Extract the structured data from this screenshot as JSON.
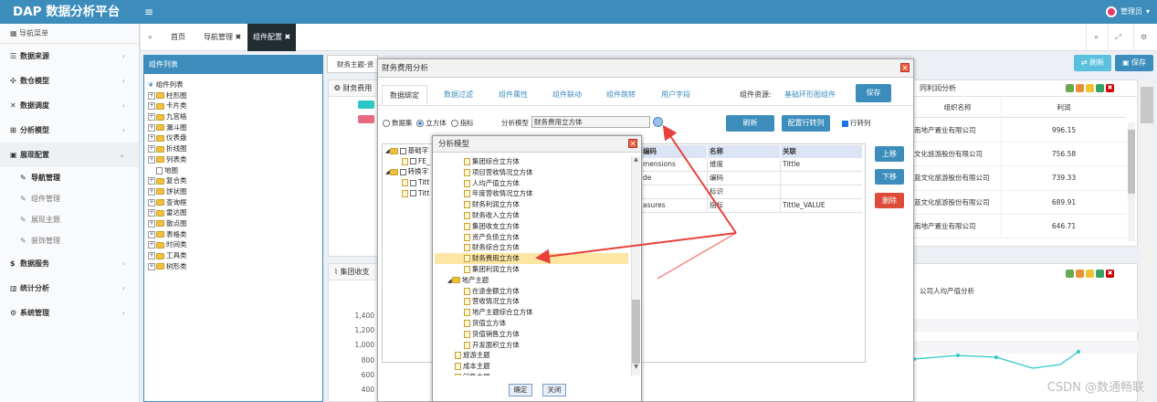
{
  "app": {
    "title": "DAP 数据分析平台",
    "user": "管理员"
  },
  "sidebar": {
    "header": "导航菜单",
    "items": [
      {
        "label": "数据来源",
        "icon": "database-icon"
      },
      {
        "label": "数仓模型",
        "icon": "cubes-icon"
      },
      {
        "label": "数据调度",
        "icon": "random-icon"
      },
      {
        "label": "分析模型",
        "icon": "sitemap-icon"
      },
      {
        "label": "展现配置",
        "icon": "layout-icon"
      },
      {
        "label": "数据服务",
        "icon": "dollar-icon"
      },
      {
        "label": "统计分析",
        "icon": "bar-chart-icon"
      },
      {
        "label": "系统管理",
        "icon": "gear-icon"
      }
    ],
    "subitems": [
      "导航管理",
      "组件管理",
      "展现主题",
      "装饰管理"
    ]
  },
  "tabs": [
    "首页",
    "导航管理",
    "组件配置"
  ],
  "left_panel": {
    "title": "组件列表",
    "root": "组件列表",
    "nodes": [
      "柱形图",
      "卡片类",
      "九宫格",
      "漏斗图",
      "仪表盘",
      "折线图",
      "列表类",
      "地图",
      "复合类",
      "饼状图",
      "查询框",
      "雷达图",
      "散点图",
      "表格类",
      "时间类",
      "工具类",
      "树形类"
    ]
  },
  "bg": {
    "theme_tab": "财务主题-资",
    "widget1_title": "财务费用",
    "widget2_title": "集团收支",
    "profit_title": "同利润分析",
    "profit_header_name": "组织名称",
    "profit_header_value": "利润",
    "profit_rows": [
      {
        "name": "南地产置业有限公司",
        "value": "996.15"
      },
      {
        "name": "文化旅游股份有限公司",
        "value": "756.58"
      },
      {
        "name": "蓝文化旅游股份有限公司",
        "value": "739.33"
      },
      {
        "name": "蓝文化旅游股份有限公司",
        "value": "689.91"
      },
      {
        "name": "南地产置业有限公司",
        "value": "646.71"
      }
    ],
    "per_capita_title": "公司人均产值分析",
    "y_ticks": [
      "1,400",
      "1,200",
      "1,000",
      "800",
      "600",
      "400"
    ],
    "refresh_label": "刷新",
    "save_label": "保存"
  },
  "main_modal": {
    "title": "财务费用分析",
    "tabs": [
      "数据绑定",
      "数据过滤",
      "组件属性",
      "组件联动",
      "组件跳转",
      "用户字段"
    ],
    "resource_label": "组件资源:",
    "resource_value": "基础环形图组件",
    "save": "保存",
    "radios": [
      "数据集",
      "立方体",
      "指标"
    ],
    "model_label": "分析模型",
    "model_value": "财务费用立方体",
    "refresh": "刷新",
    "config_row_col": "配置行转列",
    "row_to_col": "行转列",
    "tree_nodes": [
      "基础字",
      "FE_",
      "转换字",
      "Titt",
      "Titt"
    ],
    "table_headers": [
      "编码",
      "名称",
      "关联"
    ],
    "table_rows": [
      [
        "mensions",
        "维度",
        "Tittle"
      ],
      [
        "de",
        "编码",
        ""
      ],
      [
        "",
        "标识",
        ""
      ],
      [
        "asures",
        "指标",
        "Tittle_VALUE"
      ]
    ],
    "up": "上移",
    "down": "下移",
    "delete": "删除"
  },
  "tree_modal": {
    "title": "分析模型",
    "rows": [
      "集团综合立方体",
      "项目营收情况立方体",
      "人均产值立方体",
      "年度营收情况立方体",
      "财务利润立方体",
      "财务收入立方体",
      "集团收支立方体",
      "资产负债立方体",
      "财务综合立方体",
      "财务费用立方体",
      "集团利润立方体"
    ],
    "group": "地产主题",
    "group_rows": [
      "在途金额立方体",
      "营收情况立方体",
      "地产主题综合立方体",
      "货值立方体",
      "货值销售立方体",
      "开发面积立方体"
    ],
    "others": [
      "旅游主题",
      "成本主题",
      "销售主题"
    ],
    "ok": "确定",
    "close": "关闭"
  },
  "watermark": "CSDN @数通畅联",
  "colors": {
    "primary": "#3c8dbc",
    "danger": "#dd4b39",
    "highlight": "#fbe6a3",
    "arrow": "#e8403a"
  }
}
